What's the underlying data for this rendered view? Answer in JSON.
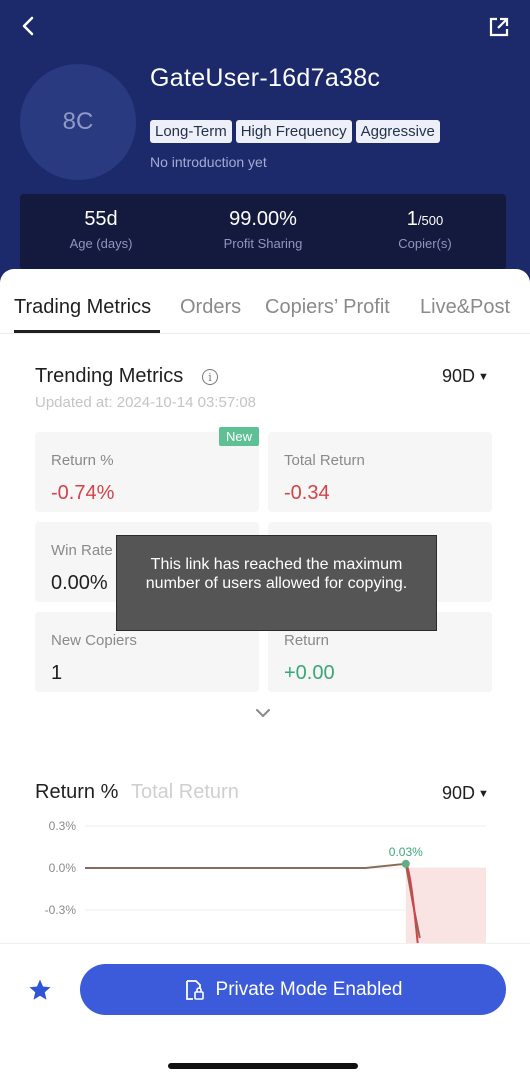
{
  "profile": {
    "avatar_text": "8C",
    "username": "GateUser-16d7a38c",
    "tags": [
      "Long-Term",
      "High Frequency",
      "Aggressive"
    ],
    "introduction": "No introduction yet"
  },
  "stats": [
    {
      "value": "55d",
      "suffix": "",
      "label": "Age (days)"
    },
    {
      "value": "99.00%",
      "suffix": "",
      "label": "Profit Sharing"
    },
    {
      "value": "1",
      "suffix": "/500",
      "label": "Copier(s)"
    }
  ],
  "tabs": [
    "Trading Metrics",
    "Orders",
    "Copiers’ Profit",
    "Live&Post"
  ],
  "metrics": {
    "title": "Trending Metrics",
    "updated": "Updated at: 2024-10-14 03:57:08",
    "period": "90D",
    "new_badge": "New",
    "cards": [
      {
        "label": "Return %",
        "value": "-0.74%"
      },
      {
        "label": "Total Return",
        "value": "-0.34"
      },
      {
        "label": "Win Rate",
        "value": "0.00%"
      },
      {
        "label": "",
        "value": ""
      },
      {
        "label": "New Copiers",
        "value": "1"
      },
      {
        "label": "Return",
        "value": "+0.00"
      }
    ]
  },
  "toast": "This link has reached the maximum number of users allowed for copying.",
  "return_chart": {
    "tab_active": "Return %",
    "tab_inactive": "Total Return",
    "period": "90D",
    "y_ticks": [
      "0.3%",
      "0.0%",
      "-0.3%"
    ],
    "peak_label": "0.03%"
  },
  "chart_data": {
    "type": "line",
    "y_ticks": [
      0.3,
      0.0,
      -0.3
    ],
    "x": [
      0,
      1,
      2,
      3,
      4,
      5,
      6,
      7,
      8,
      9,
      10
    ],
    "values": [
      0,
      0,
      0,
      0,
      0,
      0,
      0,
      0,
      0.03,
      -0.25,
      -0.5
    ],
    "annotation": "0.03%"
  },
  "bottom": {
    "button_label": "Private Mode Enabled"
  },
  "colors": {
    "header": "#1c2a6c",
    "accent": "#3b5bdb",
    "negative": "#d5424a",
    "positive": "#3aa776"
  }
}
